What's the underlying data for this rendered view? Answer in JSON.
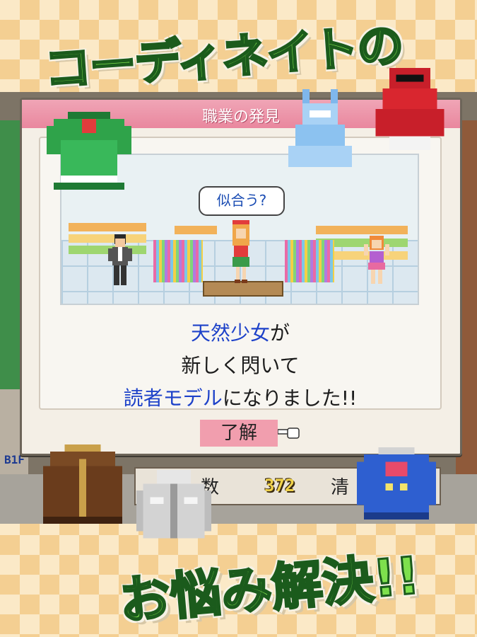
{
  "banner": {
    "top": "コーディネイトの",
    "bottom": "お悩み解決!!"
  },
  "dialog": {
    "title": "職業の発見",
    "bubble": "似合う?",
    "message": {
      "line1_highlight": "天然少女",
      "line1_rest": "が",
      "line2": "新しく閃いて",
      "line3_highlight": "読者モデル",
      "line3_rest": "になりました!!"
    },
    "ok_label": "了解"
  },
  "background_hud": {
    "floor_label": "B1F",
    "stat_label": "数",
    "stat_value": "372",
    "stat_label2": "清"
  },
  "icons": [
    "green-dress-icon",
    "blue-dress-icon",
    "red-gown-icon",
    "brown-coat-icon",
    "white-jacket-icon",
    "blue-uniform-icon",
    "pointing-hand-icon"
  ],
  "colors": {
    "banner_fill": "#7ee04d",
    "banner_stroke": "#1b5b1c",
    "titlebar": "#e9879e",
    "highlight_text": "#1e42c9",
    "ok_button": "#f19eae"
  }
}
